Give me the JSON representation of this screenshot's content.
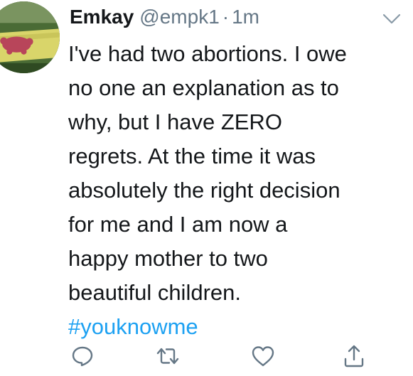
{
  "tweet": {
    "author_name": "Emkay",
    "handle": "@empk1",
    "separator": "·",
    "time": "1m",
    "text_lines": [
      "I've had two abortions. I owe",
      "no one an explanation as to",
      "why, but I have ZERO",
      "regrets. At the time it was",
      "absolutely the right decision",
      "for me and I am now a",
      "happy mother to two",
      "beautiful children."
    ],
    "hashtag": "#youknowme"
  },
  "icons": {
    "caret": "chevron-down-icon",
    "reply": "reply-icon",
    "retweet": "retweet-icon",
    "like": "heart-icon",
    "share": "share-icon"
  },
  "colors": {
    "text": "#14171a",
    "secondary": "#657786",
    "link": "#1da1f2",
    "icon": "#657786"
  }
}
